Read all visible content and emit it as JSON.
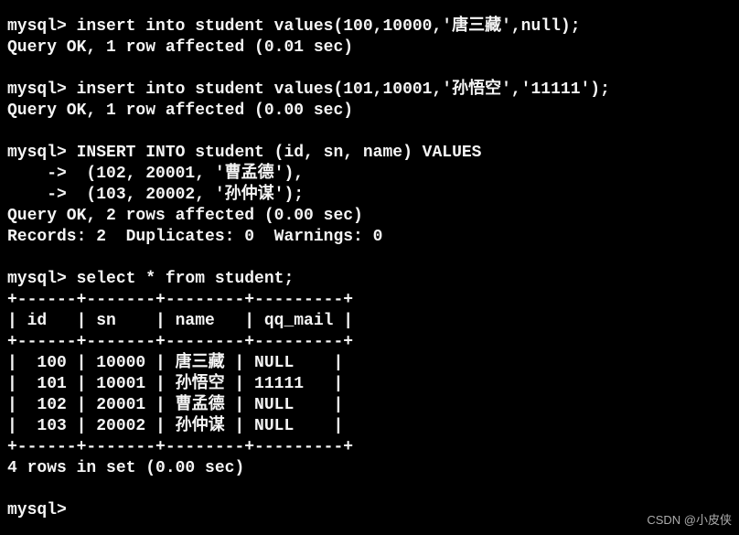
{
  "terminal": {
    "lines": [
      "mysql> insert into student values(100,10000,'唐三藏',null);",
      "Query OK, 1 row affected (0.01 sec)",
      "",
      "mysql> insert into student values(101,10001,'孙悟空','11111');",
      "Query OK, 1 row affected (0.00 sec)",
      "",
      "mysql> INSERT INTO student (id, sn, name) VALUES",
      "    ->  (102, 20001, '曹孟德'),",
      "    ->  (103, 20002, '孙仲谋');",
      "Query OK, 2 rows affected (0.00 sec)",
      "Records: 2  Duplicates: 0  Warnings: 0",
      "",
      "mysql> select * from student;",
      "+------+-------+--------+---------+",
      "| id   | sn    | name   | qq_mail |",
      "+------+-------+--------+---------+",
      "|  100 | 10000 | 唐三藏 | NULL    |",
      "|  101 | 10001 | 孙悟空 | 11111   |",
      "|  102 | 20001 | 曹孟德 | NULL    |",
      "|  103 | 20002 | 孙仲谋 | NULL    |",
      "+------+-------+--------+---------+",
      "4 rows in set (0.00 sec)",
      "",
      "mysql> "
    ]
  },
  "table_data": {
    "columns": [
      "id",
      "sn",
      "name",
      "qq_mail"
    ],
    "rows": [
      {
        "id": 100,
        "sn": 10000,
        "name": "唐三藏",
        "qq_mail": "NULL"
      },
      {
        "id": 101,
        "sn": 10001,
        "name": "孙悟空",
        "qq_mail": "11111"
      },
      {
        "id": 102,
        "sn": 20001,
        "name": "曹孟德",
        "qq_mail": "NULL"
      },
      {
        "id": 103,
        "sn": 20002,
        "name": "孙仲谋",
        "qq_mail": "NULL"
      }
    ],
    "row_count": 4
  },
  "watermark": "CSDN @小皮侠"
}
